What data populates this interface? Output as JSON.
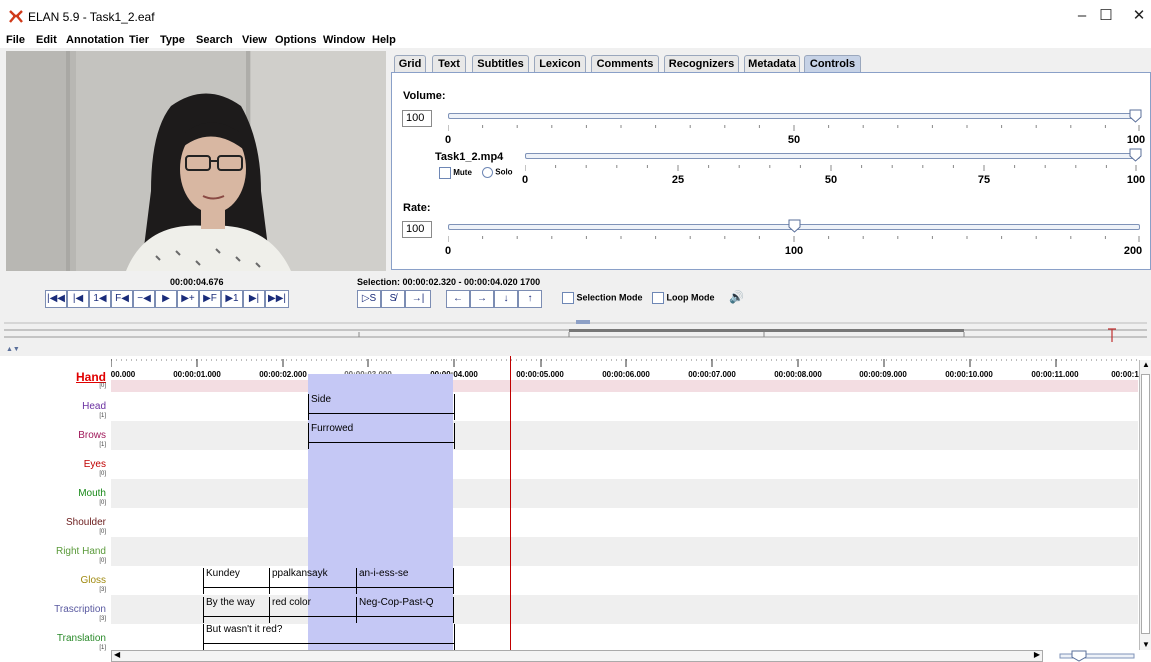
{
  "window": {
    "title": "ELAN 5.9 - Task1_2.eaf",
    "minimize": "–",
    "maximize": "☐",
    "close": "✕"
  },
  "menu": [
    "File",
    "Edit",
    "Annotation",
    "Tier",
    "Type",
    "Search",
    "View",
    "Options",
    "Window",
    "Help"
  ],
  "tabs": [
    "Grid",
    "Text",
    "Subtitles",
    "Lexicon",
    "Comments",
    "Recognizers",
    "Metadata",
    "Controls"
  ],
  "active_tab": "Controls",
  "controls": {
    "volume_label": "Volume:",
    "volume_value": "100",
    "volume_ticks": [
      "0",
      "50",
      "100"
    ],
    "volume_level": 100,
    "media_file": "Task1_2.mp4",
    "mute_label": "Mute",
    "solo_label": "Solo",
    "media_ticks": [
      "0",
      "25",
      "50",
      "75",
      "100"
    ],
    "media_level": 100,
    "rate_label": "Rate:",
    "rate_value": "100",
    "rate_ticks": [
      "0",
      "100",
      "200"
    ],
    "rate_level": 100
  },
  "player": {
    "current_time": "00:00:04.676",
    "selection": "Selection: 00:00:02.320 - 00:00:04.020  1700",
    "nav_buttons": [
      "|◀◀",
      "|◀",
      "1◀",
      "F◀",
      "−◀",
      "▶",
      "▶+",
      "▶F",
      "▶1",
      "▶|",
      "▶▶|"
    ],
    "sel_buttons": [
      "▷S",
      "S̸",
      "→|"
    ],
    "arrow_buttons": [
      "←",
      "→",
      "↓",
      "↑"
    ],
    "selection_mode": "Selection Mode",
    "loop_mode": "Loop Mode",
    "speaker_icon": "🔊"
  },
  "ruler": [
    "00.000",
    "00:00:01.000",
    "00:00:02.000",
    "00:00:03.000",
    "00:00:04.000",
    "00:00:05.000",
    "00:00:06.000",
    "00:00:07.000",
    "00:00:08.000",
    "00:00:09.000",
    "00:00:10.000",
    "00:00:11.000",
    "00:00:1"
  ],
  "tiers": [
    {
      "name": "Hand",
      "index": "[0]",
      "color": "#e00000"
    },
    {
      "name": "Head",
      "index": "[1]",
      "color": "#6a2fa0"
    },
    {
      "name": "Brows",
      "index": "[1]",
      "color": "#a0185a"
    },
    {
      "name": "Eyes",
      "index": "[0]",
      "color": "#c00000"
    },
    {
      "name": "Mouth",
      "index": "[0]",
      "color": "#1a8a1a"
    },
    {
      "name": "Shoulder",
      "index": "[0]",
      "color": "#6b1c1c"
    },
    {
      "name": "Right Hand",
      "index": "[0]",
      "color": "#5a9a3a"
    },
    {
      "name": "Gloss",
      "index": "[3]",
      "color": "#a08a10"
    },
    {
      "name": "Trascription",
      "index": "[3]",
      "color": "#5a5aa0"
    },
    {
      "name": "Translation",
      "index": "[1]",
      "color": "#2a8a2a"
    }
  ],
  "annotations": {
    "head": [
      "Side"
    ],
    "brows": [
      "Furrowed"
    ],
    "gloss": [
      "Kundey",
      "ppalkansayk",
      "an-i-ess-se"
    ],
    "transcription": [
      "By the way",
      "red color",
      "Neg-Cop-Past-Q"
    ],
    "translation": [
      "But wasn't it red?"
    ]
  }
}
